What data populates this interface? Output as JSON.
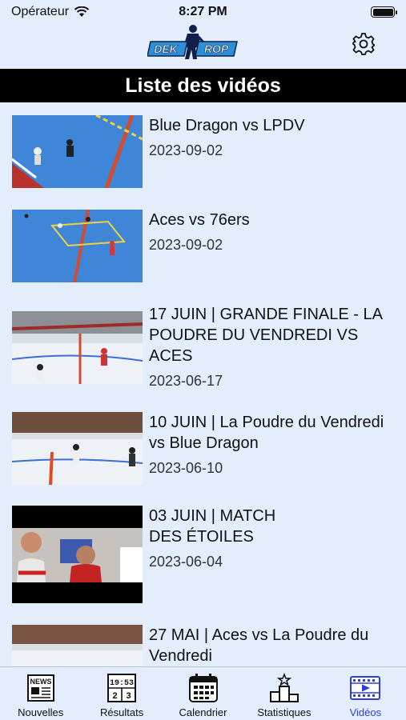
{
  "status_bar": {
    "carrier": "Opérateur",
    "time": "8:27 PM"
  },
  "header": {
    "logo_text": "DEK ROP",
    "settings_icon": "gear-icon"
  },
  "page_title": "Liste des vidéos",
  "videos": [
    {
      "title": "Blue Dragon vs LPDV",
      "date": "2023-09-02"
    },
    {
      "title": "Aces vs 76ers",
      "date": "2023-09-02"
    },
    {
      "title": "17 JUIN | GRANDE FINALE - LA POUDRE DU VENDREDI VS ACES",
      "date": "2023-06-17"
    },
    {
      "title": "10 JUIN | La Poudre du Vendredi vs Blue Dragon",
      "date": "2023-06-10"
    },
    {
      "title": "03 JUIN | MATCH DES ÉTOILES",
      "date": "2023-06-04"
    },
    {
      "title": "27 MAI | Aces vs La Poudre du Vendredi",
      "date": ""
    }
  ],
  "tabs": [
    {
      "label": "Nouvelles",
      "icon": "newspaper-icon",
      "active": false,
      "icon_text": "NEWS"
    },
    {
      "label": "Résultats",
      "icon": "scoreboard-icon",
      "active": false,
      "icon_text": "19:53",
      "icon_text2": "2",
      "icon_text3": "3"
    },
    {
      "label": "Calendrier",
      "icon": "calendar-icon",
      "active": false
    },
    {
      "label": "Statistiques",
      "icon": "podium-icon",
      "active": false
    },
    {
      "label": "Vidéos",
      "icon": "video-icon",
      "active": true
    }
  ],
  "colors": {
    "active_tab": "#2b3fd6",
    "background": "#e3edfb",
    "title_bar": "#000000"
  }
}
